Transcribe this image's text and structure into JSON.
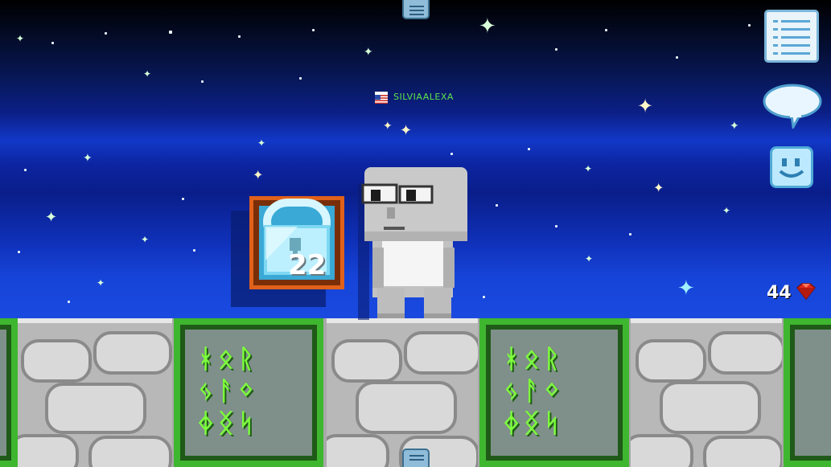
{
  "player": {
    "name": "SILVIAALEXA",
    "flag": "us-flag"
  },
  "inventory_item": {
    "name": "Diamond Lock",
    "quantity": "22"
  },
  "hud": {
    "gems": "44",
    "gem_icon": "red-gem-icon"
  },
  "buttons": {
    "menu_top": "menu-tab-icon",
    "menu_bottom": "menu-tab-icon",
    "list": "list-icon",
    "chat": "chat-bubble-icon",
    "emote": "smiley-icon"
  },
  "colors": {
    "sky_top": "#000000",
    "sky_bottom": "#1a4ae0",
    "player_name": "#5ee24a",
    "rune_border": "#3fb62f",
    "gem": "#e02a1c"
  }
}
